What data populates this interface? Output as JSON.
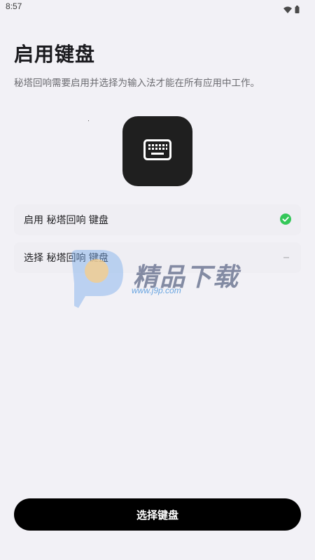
{
  "status_bar": {
    "time": "8:57",
    "icons": [
      "wifi-icon",
      "battery-icon"
    ]
  },
  "header": {
    "title": "启用键盘",
    "description": "秘塔回响需要启用并选择为输入法才能在所有应用中工作。"
  },
  "hero": {
    "icon": "keyboard-icon"
  },
  "steps": [
    {
      "label": "启用 秘塔回响 键盘",
      "status": "done",
      "status_icon": "check-circle-icon",
      "status_color": "#34c759"
    },
    {
      "label": "选择 秘塔回响 键盘",
      "status": "pending",
      "status_icon": "dash-icon"
    }
  ],
  "watermark": {
    "text": "精品下载",
    "url": "www.j9p.com"
  },
  "footer": {
    "button_label": "选择键盘"
  },
  "colors": {
    "background": "#f2f1f6",
    "primary_button": "#000000",
    "success": "#34c759"
  }
}
